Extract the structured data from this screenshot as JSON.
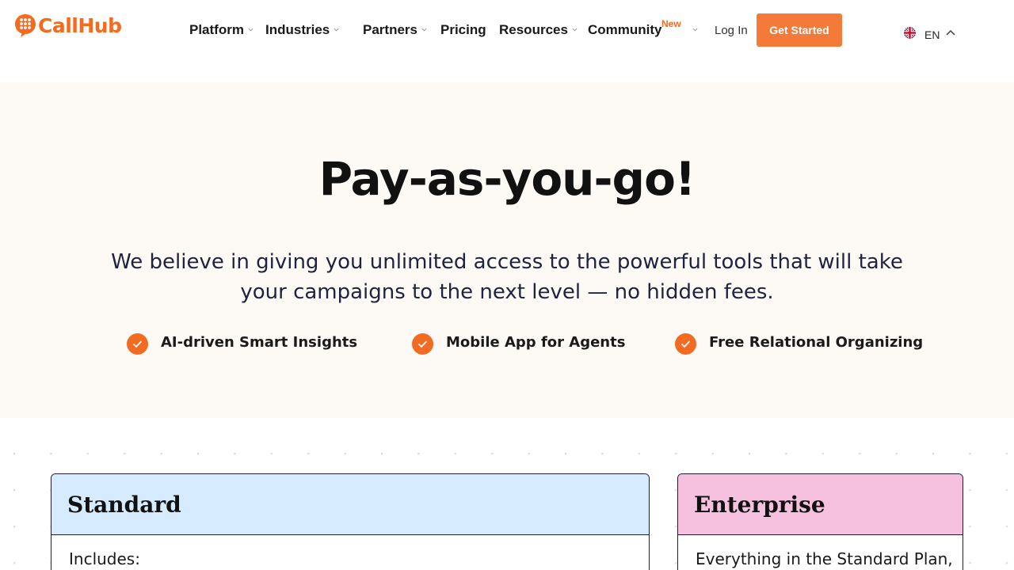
{
  "brand": {
    "name": "CallHub",
    "color": "#f26b21"
  },
  "nav": {
    "items": [
      {
        "label": "Platform",
        "dropdown": true
      },
      {
        "label": "Industries",
        "dropdown": true
      },
      {
        "label": "Partners",
        "dropdown": true
      },
      {
        "label": "Pricing",
        "dropdown": false
      },
      {
        "label": "Resources",
        "dropdown": true
      },
      {
        "label": "Community",
        "dropdown": true,
        "badge": "New"
      }
    ],
    "login_label": "Log In",
    "cta_label": "Get Started",
    "language": "EN"
  },
  "hero": {
    "title": "Pay-as-you-go!",
    "subtitle": "We believe in giving you unlimited access to the powerful tools that will take your campaigns to the next level — no hidden fees.",
    "features": [
      "AI-driven Smart Insights",
      "Mobile App for Agents",
      "Free Relational Organizing"
    ]
  },
  "plans": [
    {
      "name": "Standard",
      "body": "Includes:",
      "header_color": "#d6ebfd"
    },
    {
      "name": "Enterprise",
      "body": "Everything in the Standard Plan,",
      "header_color": "#f6c1df"
    }
  ]
}
